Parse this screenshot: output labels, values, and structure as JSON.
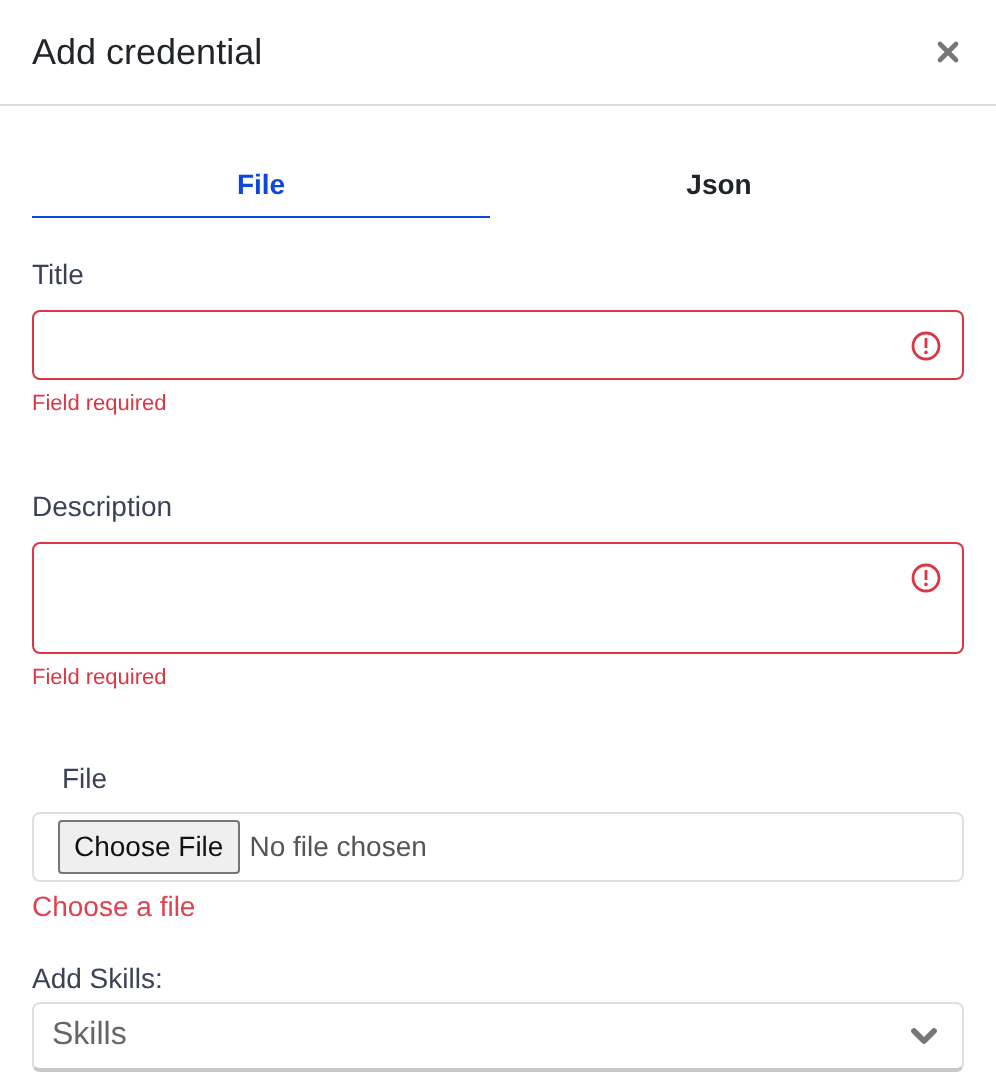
{
  "dialog": {
    "title": "Add credential"
  },
  "tabs": [
    {
      "label": "File",
      "selected": true
    },
    {
      "label": "Json",
      "selected": false
    }
  ],
  "fields": [
    {
      "kind": "text",
      "label": "Title",
      "invalid": true,
      "error": "Field required"
    },
    {
      "kind": "textarea",
      "label": "Description",
      "invalid": true,
      "error": "Field required"
    }
  ],
  "file": {
    "label": "File",
    "button": "Choose File",
    "status": "No file chosen",
    "error": "Choose a file"
  },
  "skills": {
    "label": "Add Skills:",
    "placeholder": "Skills"
  }
}
